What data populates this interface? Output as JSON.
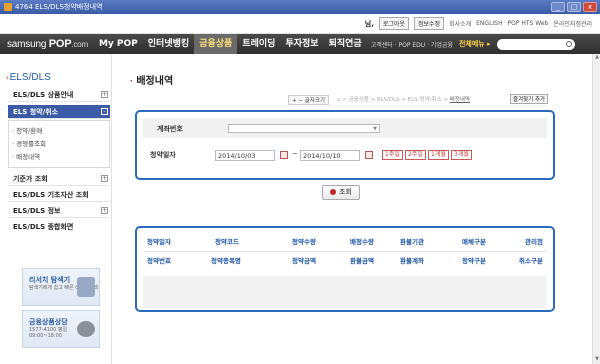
{
  "window": {
    "title": "4764 ELS/DLS청약배정내역",
    "buttons": [
      "_",
      "□",
      "x"
    ]
  },
  "util": {
    "user": "님,",
    "logout": "로그아웃",
    "account": "정보수정",
    "links": [
      "회사소개",
      "ENGLISH",
      "POP HTS Web",
      "온라인지점관리"
    ]
  },
  "nav": {
    "logo_samsung": "samsung",
    "logo_pop": "POP",
    "logo_com": ".com",
    "items": [
      "My POP",
      "인터넷뱅킹",
      "금융상품",
      "트레이딩",
      "투자정보",
      "퇴직연금"
    ],
    "active_index": 2,
    "sub": "고객센터 · POP EDU · 기업금융",
    "all_menu": "전체메뉴 ▸"
  },
  "sidebar": {
    "title": "ELS/DLS",
    "items": [
      {
        "label": "ELS/DLS 상품안내",
        "plus": "+"
      },
      {
        "label": "ELS 청약/취소",
        "plus": "-"
      },
      {
        "label": "기준가 조회",
        "plus": "+"
      },
      {
        "label": "ELS/DLS 기초자산 조회",
        "plus": ""
      },
      {
        "label": "ELS/DLS 정보",
        "plus": "+"
      },
      {
        "label": "ELS/DLS 종합화면",
        "plus": ""
      }
    ],
    "subitems": [
      "· 청약/환매",
      "· 경쟁률조회",
      "· 배정내역"
    ],
    "banners": [
      {
        "title": "리서치 탐색기",
        "desc": "탐색기에게 쉽고\n빠른 리서치검색"
      },
      {
        "title": "금융상품상담",
        "desc": "1577-4100\n평일09:00~18:00"
      }
    ]
  },
  "content": {
    "title": "배정내역",
    "font_size_btn": "+ − 글자크기",
    "breadcrumbs": [
      "⌂",
      "금융상품",
      "ELS/DLS",
      "ELS 청약/취소",
      "배정내역"
    ],
    "favorite_btn": "즐겨찾기 추가",
    "form": {
      "account_label": "계좌번호",
      "account_value": "",
      "date_label": "청약일자",
      "date_from": "2014/10/03",
      "date_to": "2014/10/10",
      "tilde": "~",
      "periods": [
        "1주일",
        "2주일",
        "1개월",
        "3개월"
      ]
    },
    "search_label": "조회",
    "table": {
      "header_row1": [
        "청약일자",
        "청약코드",
        "청약수량",
        "배정수량",
        "환불기관",
        "매체구분",
        "관리점"
      ],
      "header_row2": [
        "청약번호",
        "청약종목명",
        "청약금액",
        "환불금액",
        "환불계좌",
        "청약구분",
        "취소구분"
      ]
    }
  },
  "colors": {
    "accent_blue": "#2b6bbd",
    "brand_red": "#d33333",
    "nav_dark": "#2e2e2e"
  }
}
